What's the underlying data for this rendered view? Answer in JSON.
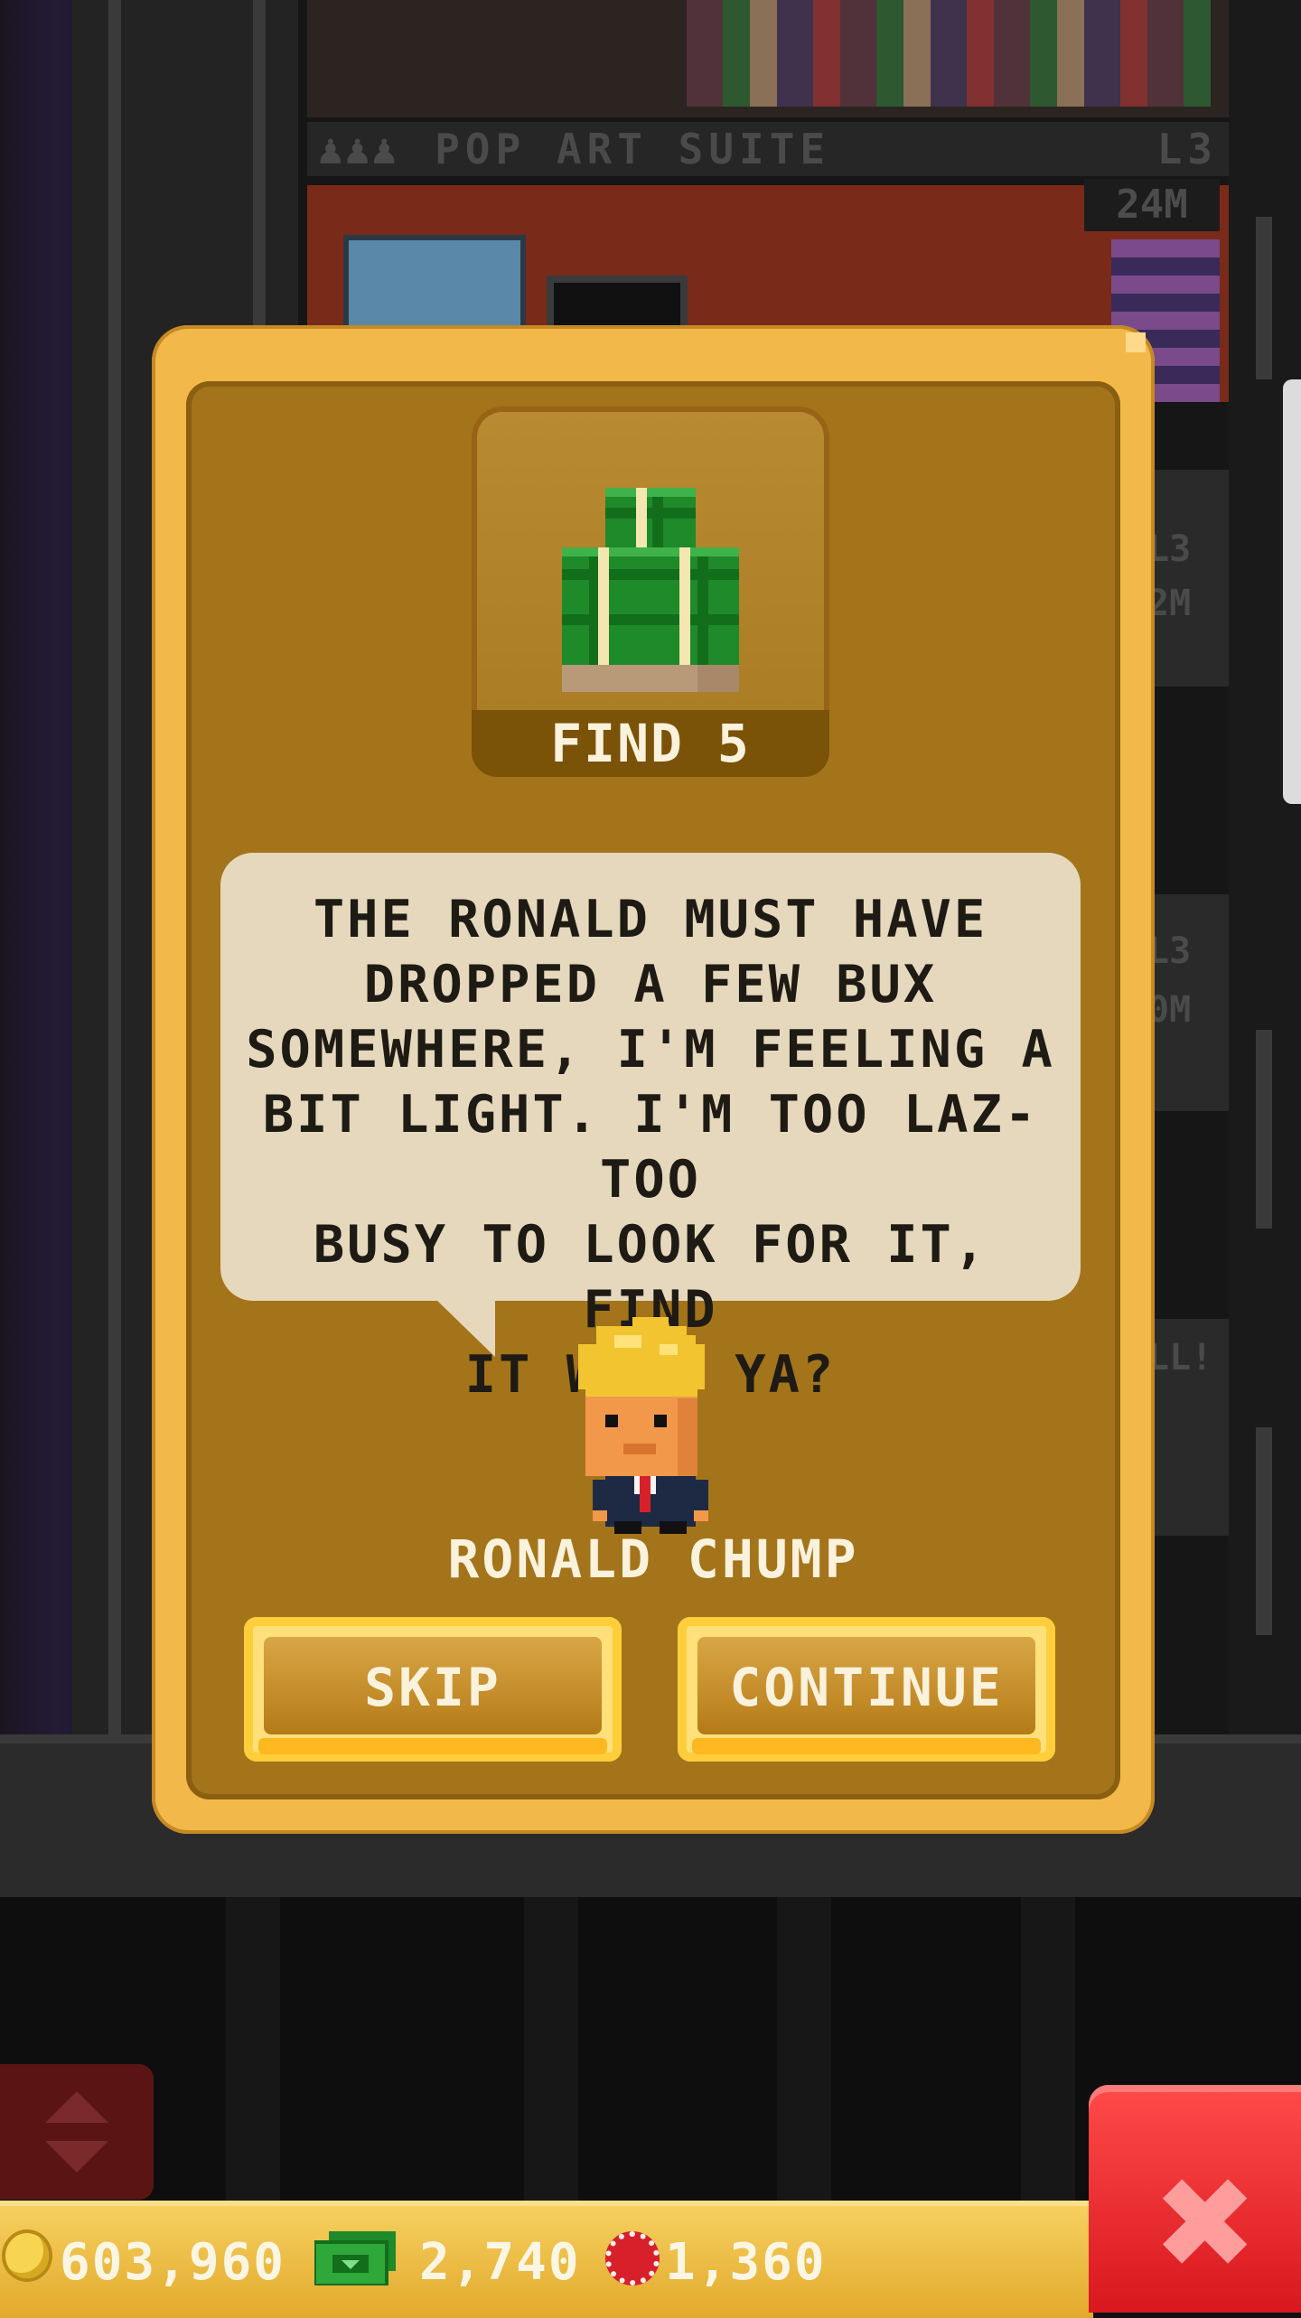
{
  "background": {
    "floor_name": "POP ART SUITE",
    "floor_level": "L3",
    "floor_price": "24M",
    "side_labels": [
      "L3",
      "2M",
      "L3",
      "0M",
      "LL!"
    ]
  },
  "dialog": {
    "reward": {
      "icon": "bux-stack-icon",
      "label": "FIND 5"
    },
    "message": "THE RONALD MUST HAVE\nDROPPED A FEW BUX\nSOMEWHERE, I'M FEELING A\nBIT LIGHT. I'M TOO LAZ- TOO\nBUSY TO LOOK FOR IT, FIND\nIT WILL YA?",
    "npc_name": "RONALD CHUMP",
    "buttons": {
      "skip": "SKIP",
      "continue": "CONTINUE"
    }
  },
  "hud": {
    "coins": "603,960",
    "bux": "2,740",
    "chips": "1,360"
  },
  "colors": {
    "dialog_frame": "#f2b94a",
    "dialog_inner": "#a3741a",
    "bubble": "#e5d8bc",
    "close_button": "#e02a2a",
    "hud_bar": "#eab63a"
  }
}
